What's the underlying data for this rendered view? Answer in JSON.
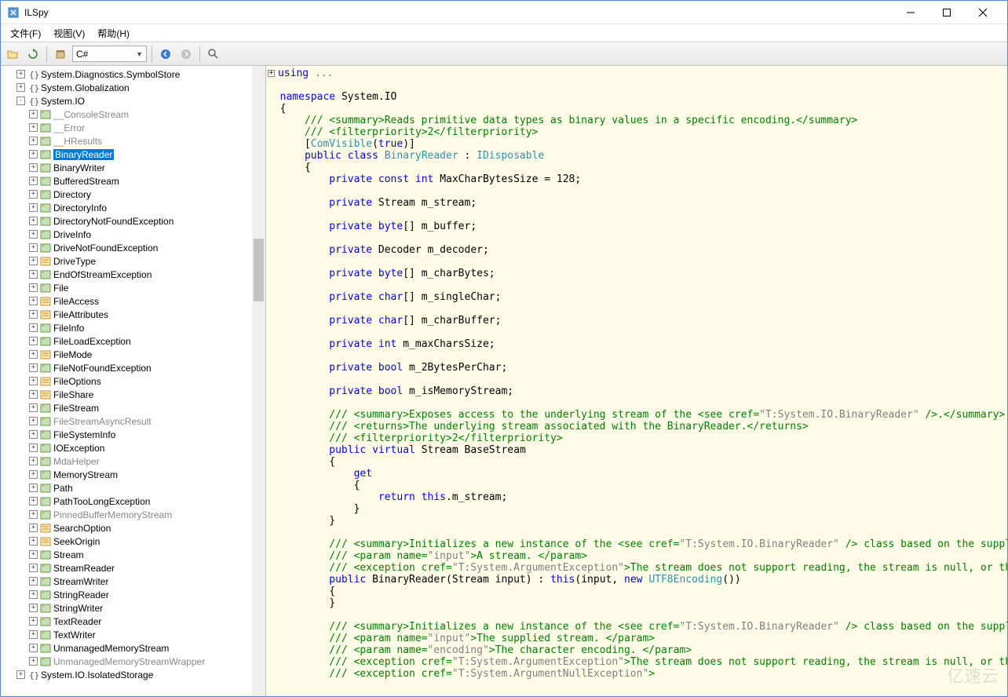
{
  "window": {
    "title": "ILSpy"
  },
  "menubar": {
    "file": "文件(F)",
    "view": "视图(V)",
    "help": "帮助(H)"
  },
  "toolbar": {
    "language": "C#"
  },
  "tree": {
    "top": [
      {
        "indent": 1,
        "toggle": "+",
        "icon": "ns",
        "label": "System.Diagnostics.SymbolStore"
      },
      {
        "indent": 1,
        "toggle": "+",
        "icon": "ns",
        "label": "System.Globalization"
      },
      {
        "indent": 1,
        "toggle": "-",
        "icon": "ns",
        "label": "System.IO"
      }
    ],
    "io": [
      {
        "label": "__ConsoleStream",
        "gray": true
      },
      {
        "label": "__Error",
        "gray": true
      },
      {
        "label": "__HResults",
        "gray": true
      },
      {
        "label": "BinaryReader",
        "selected": true
      },
      {
        "label": "BinaryWriter"
      },
      {
        "label": "BufferedStream"
      },
      {
        "label": "Directory"
      },
      {
        "label": "DirectoryInfo"
      },
      {
        "label": "DirectoryNotFoundException"
      },
      {
        "label": "DriveInfo"
      },
      {
        "label": "DriveNotFoundException"
      },
      {
        "label": "DriveType",
        "icon": "enum"
      },
      {
        "label": "EndOfStreamException"
      },
      {
        "label": "File"
      },
      {
        "label": "FileAccess",
        "icon": "enum"
      },
      {
        "label": "FileAttributes",
        "icon": "enum"
      },
      {
        "label": "FileInfo"
      },
      {
        "label": "FileLoadException"
      },
      {
        "label": "FileMode",
        "icon": "enum"
      },
      {
        "label": "FileNotFoundException"
      },
      {
        "label": "FileOptions",
        "icon": "enum"
      },
      {
        "label": "FileShare",
        "icon": "enum"
      },
      {
        "label": "FileStream"
      },
      {
        "label": "FileStreamAsyncResult",
        "gray": true
      },
      {
        "label": "FileSystemInfo"
      },
      {
        "label": "IOException"
      },
      {
        "label": "MdaHelper",
        "gray": true
      },
      {
        "label": "MemoryStream"
      },
      {
        "label": "Path"
      },
      {
        "label": "PathTooLongException"
      },
      {
        "label": "PinnedBufferMemoryStream",
        "gray": true
      },
      {
        "label": "SearchOption",
        "icon": "enum"
      },
      {
        "label": "SeekOrigin",
        "icon": "enum"
      },
      {
        "label": "Stream"
      },
      {
        "label": "StreamReader"
      },
      {
        "label": "StreamWriter"
      },
      {
        "label": "StringReader"
      },
      {
        "label": "StringWriter"
      },
      {
        "label": "TextReader"
      },
      {
        "label": "TextWriter"
      },
      {
        "label": "UnmanagedMemoryStream"
      },
      {
        "label": "UnmanagedMemoryStreamWrapper",
        "gray": true
      }
    ],
    "bottom": [
      {
        "indent": 1,
        "toggle": "+",
        "icon": "ns",
        "label": "System.IO.IsolatedStorage"
      }
    ]
  },
  "code": {
    "using_label": "using",
    "namespace_kw": "namespace",
    "namespace_name": "System.IO",
    "summary1": "Reads primitive data types as binary values in a specific encoding.",
    "filterpriority": "2",
    "comvisible": "ComVisible",
    "true_kw": "true",
    "public_kw": "public",
    "class_kw": "class",
    "class_name": "BinaryReader",
    "idisposable": "IDisposable",
    "fields": [
      {
        "mods": "private const int",
        "name": "MaxCharBytesSize",
        "init": " = 128;"
      },
      {
        "mods": "private",
        "type": "Stream",
        "name": "m_stream;"
      },
      {
        "mods": "private",
        "type": "byte",
        "arr": "[]",
        "name": "m_buffer;"
      },
      {
        "mods": "private",
        "type": "Decoder",
        "name": "m_decoder;"
      },
      {
        "mods": "private",
        "type": "byte",
        "arr": "[]",
        "name": "m_charBytes;"
      },
      {
        "mods": "private",
        "type": "char",
        "arr": "[]",
        "name": "m_singleChar;"
      },
      {
        "mods": "private",
        "type": "char",
        "arr": "[]",
        "name": "m_charBuffer;"
      },
      {
        "mods": "private",
        "type": "int",
        "name": "m_maxCharsSize;"
      },
      {
        "mods": "private",
        "type": "bool",
        "name": "m_2BytesPerChar;"
      },
      {
        "mods": "private",
        "type": "bool",
        "name": "m_isMemoryStream;"
      }
    ],
    "basestream_summary": "Exposes access to the underlying stream of the ",
    "basestream_cref": "T:System.IO.BinaryReader",
    "basestream_returns": "The underlying stream associated with the BinaryReader.",
    "virtual_kw": "virtual",
    "stream_type": "Stream",
    "basestream_name": "BaseStream",
    "get_kw": "get",
    "return_kw": "return",
    "this_kw": "this",
    "m_stream": "m_stream",
    "ctor_summary": "Initializes a new instance of the ",
    "ctor_cref": "T:System.IO.BinaryReader",
    "ctor_summary2": " class based on the supplied stream",
    "param_input": "input",
    "param_input_desc": "A stream. ",
    "exc_cref": "T:System.ArgumentException",
    "exc_desc": "The stream does not support reading, the stream is null, or the stream is",
    "new_kw": "new",
    "utf8": "UTF8Encoding",
    "param_input_desc2": "The supplied stream. ",
    "param_encoding": "encoding",
    "param_encoding_desc": "The character encoding. ",
    "exc2_cref": "T:System.ArgumentNullException"
  }
}
